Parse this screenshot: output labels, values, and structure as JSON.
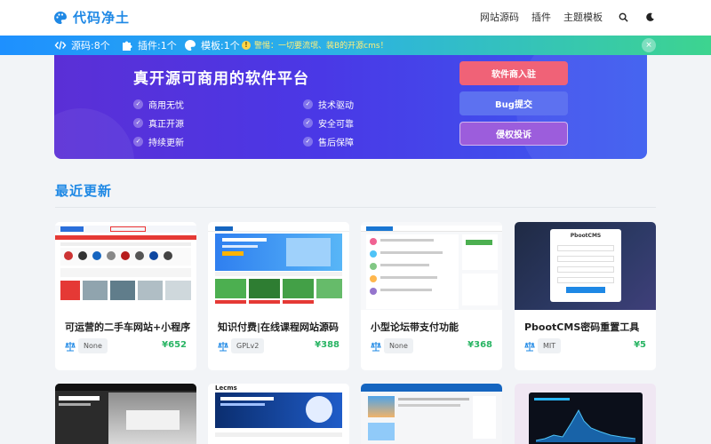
{
  "header": {
    "logo_text": "代码净土",
    "nav": [
      "网站源码",
      "插件",
      "主题模板"
    ]
  },
  "notice": {
    "stats": [
      {
        "icon": "code-icon",
        "label": "源码:8个"
      },
      {
        "icon": "puzzle-icon",
        "label": "插件:1个"
      },
      {
        "icon": "palette-icon",
        "label": "模板:1个"
      }
    ],
    "warning": "警惕：一切要流氓、装B的开源cms！",
    "close_symbol": "×"
  },
  "banner": {
    "title": "真开源可商用的软件平台",
    "features": [
      "商用无忧",
      "技术驱动",
      "真正开源",
      "安全可靠",
      "持续更新",
      "售后保障"
    ],
    "buttons": [
      {
        "label": "软件商入驻",
        "color": "#f06277"
      },
      {
        "label": "Bug提交",
        "color": "#5d71f0"
      },
      {
        "label": "侵权投诉",
        "color": "#9c5ddc"
      }
    ]
  },
  "section": {
    "title": "最近更新"
  },
  "cards": [
    {
      "title": "可运营的二手车网站+小程序",
      "license": "None",
      "price": "¥652"
    },
    {
      "title": "知识付费|在线课程网站源码",
      "license": "GPLv2",
      "price": "¥388"
    },
    {
      "title": "小型论坛带支付功能",
      "license": "None",
      "price": "¥368"
    },
    {
      "title": "PbootCMS密码重置工具",
      "license": "MIT",
      "price": "¥5"
    }
  ],
  "thumbs": {
    "pbootcms_label": "PbootCMS",
    "lecms_label": "Lecms"
  },
  "colors": {
    "brand": "#1e88e5",
    "price": "#28b463"
  }
}
